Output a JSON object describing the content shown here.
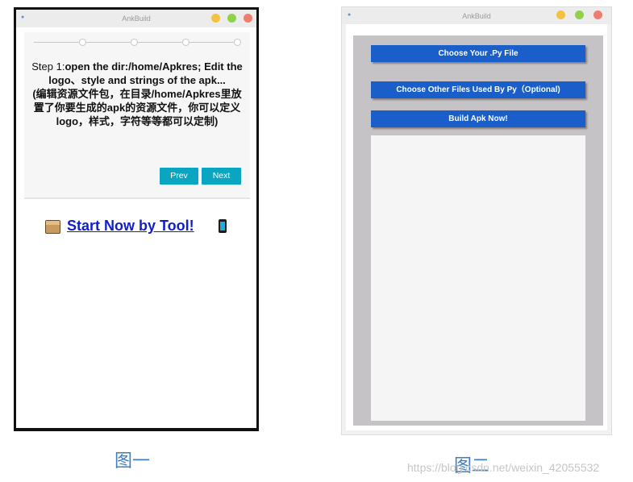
{
  "window1": {
    "title": "AnkBuild",
    "step_lead": "Step 1:",
    "step_bold": "open the dir:/home/Apkres; Edit the logo、style and strings of the apk...",
    "step_chinese": "(编辑资源文件包，在目录/home/Apkres里放置了你要生成的apk的资源文件，你可以定义logo，样式，字符等等都可以定制)",
    "prev_label": "Prev",
    "next_label": "Next",
    "start_link": "Start Now by Tool!"
  },
  "window2": {
    "title": "AnkBuild",
    "choose_py_label": "Choose Your .Py File",
    "choose_other_label": "Choose Other Files Used By Py（Optional)",
    "build_label": "Build Apk Now!"
  },
  "captions": {
    "fig1": "图一",
    "fig2": "图二",
    "watermark": "https://blog.csdn.net/weixin_42055532"
  },
  "colors": {
    "accent_teal": "#0aa5c0",
    "button_blue": "#1a5ec9",
    "link_blue": "#1020c8",
    "caption_blue": "#3f7fc1"
  }
}
